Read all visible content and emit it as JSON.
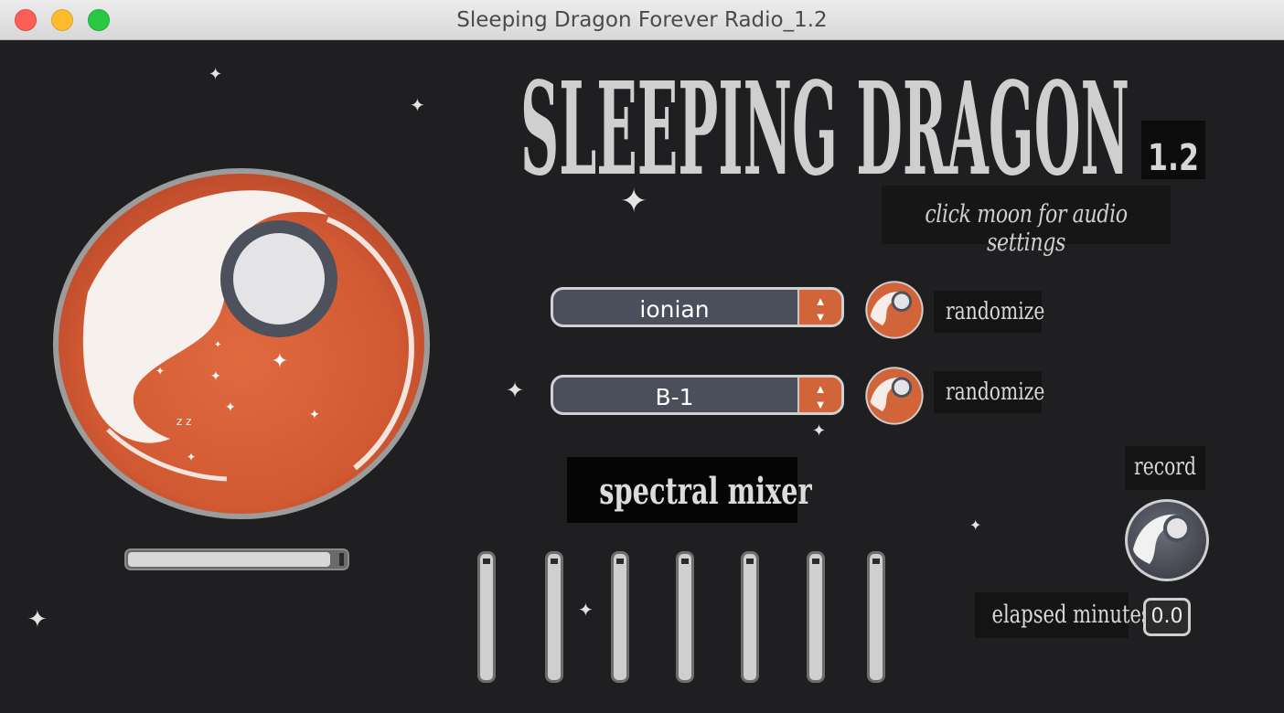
{
  "window": {
    "title": "Sleeping Dragon Forever Radio_1.2"
  },
  "header": {
    "title": "SLEEPING DRAGON",
    "version": "1.2",
    "hint": "click moon for audio settings"
  },
  "moon": {
    "icon": "moon-dragon-icon",
    "snore": "z z"
  },
  "progress": {
    "value": 0.97
  },
  "mode_select": {
    "value": "ionian",
    "randomize_label": "randomize"
  },
  "root_select": {
    "value": "B-1",
    "randomize_label": "randomize"
  },
  "mixer": {
    "title": "spectral mixer",
    "faders": [
      {
        "value": 1.0
      },
      {
        "value": 1.0
      },
      {
        "value": 1.0
      },
      {
        "value": 1.0
      },
      {
        "value": 1.0
      },
      {
        "value": 1.0
      },
      {
        "value": 1.0
      }
    ]
  },
  "record": {
    "label": "record",
    "elapsed_label": "elapsed minutes",
    "elapsed_value": "0.0"
  },
  "colors": {
    "background": "#1f1f21",
    "accent_orange": "#d2643a",
    "dark_gray": "#4b4f5b",
    "light_text": "#d8d8d8"
  }
}
